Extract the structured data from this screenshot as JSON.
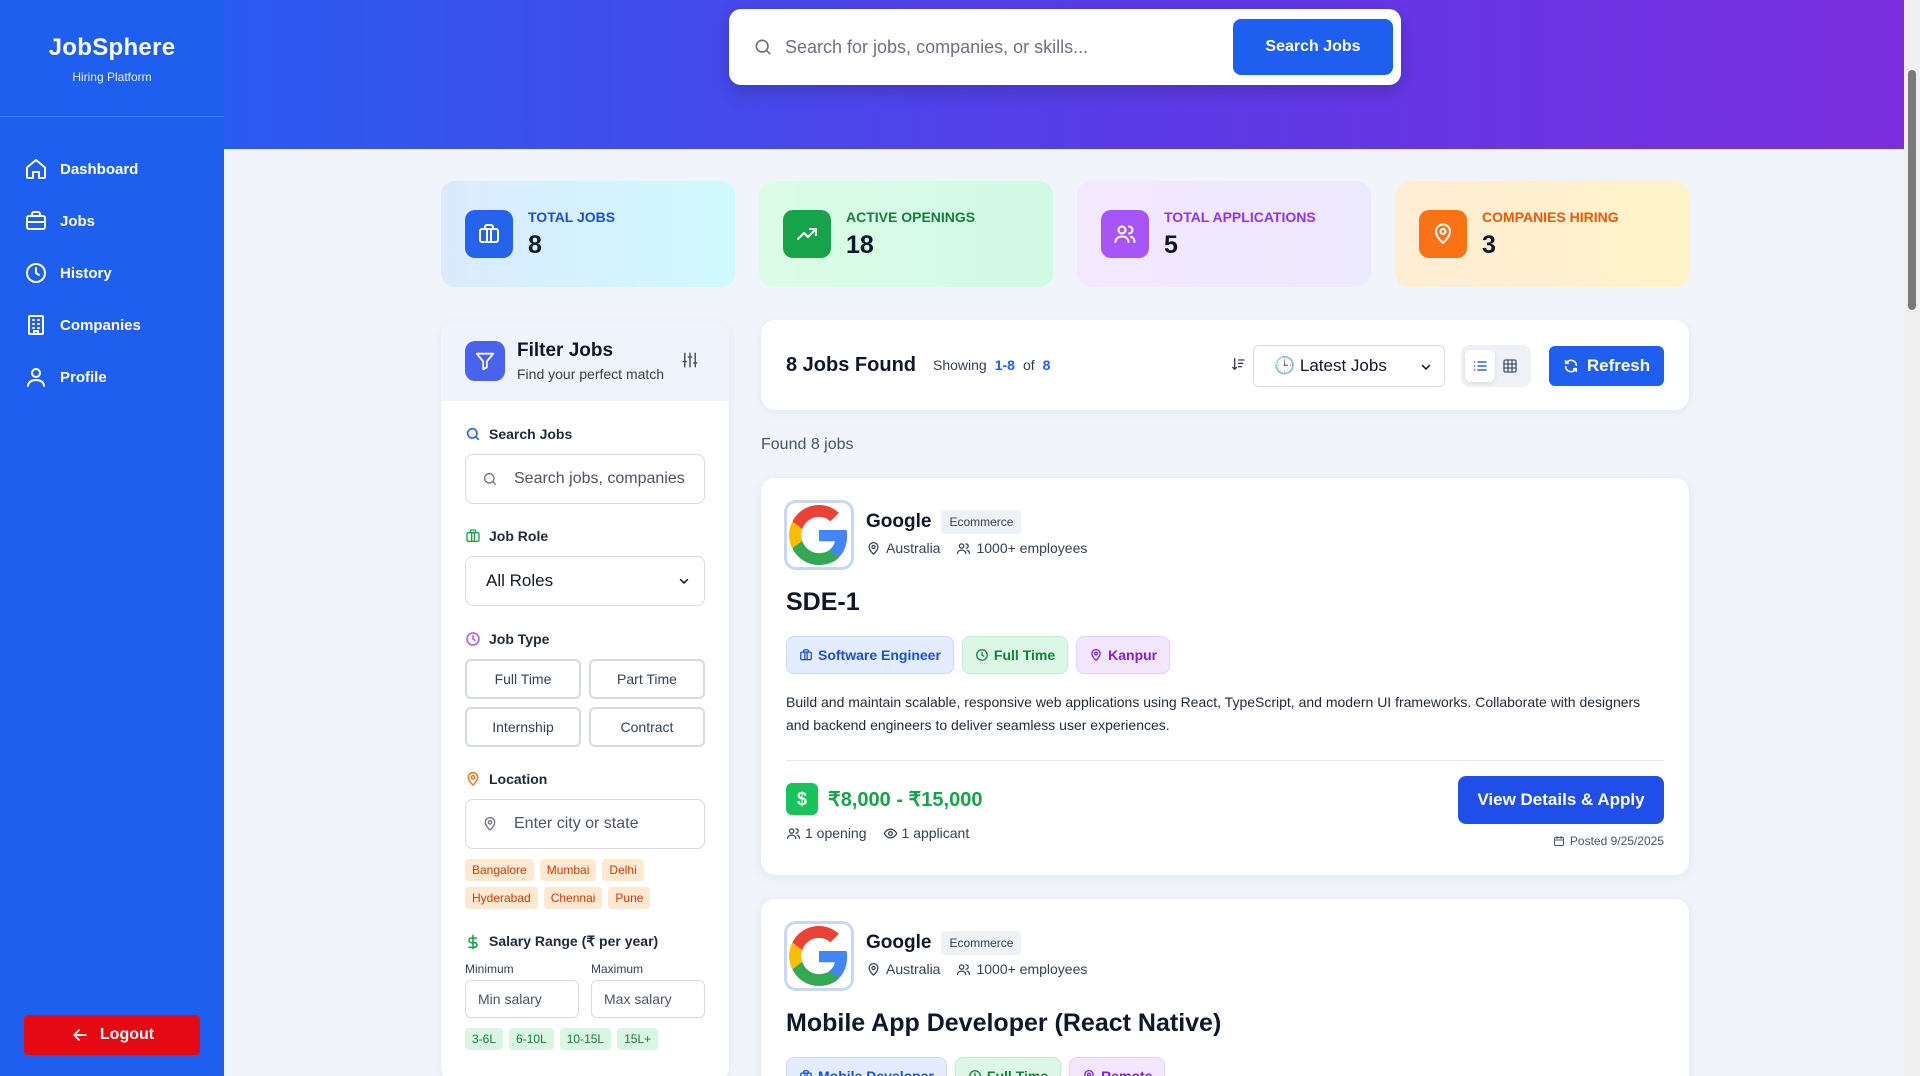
{
  "brand": {
    "name": "JobSphere",
    "subtitle": "Hiring Platform"
  },
  "sidebar": {
    "items": [
      {
        "label": "Dashboard",
        "icon": "home-icon"
      },
      {
        "label": "Jobs",
        "icon": "briefcase-icon"
      },
      {
        "label": "History",
        "icon": "clock-icon"
      },
      {
        "label": "Companies",
        "icon": "building-icon"
      },
      {
        "label": "Profile",
        "icon": "user-icon"
      }
    ],
    "logout_label": "Logout"
  },
  "hero": {
    "search_placeholder": "Search for jobs, companies, or skills...",
    "search_button": "Search Jobs"
  },
  "stats": [
    {
      "label": "TOTAL JOBS",
      "value": "8",
      "icon": "briefcase-icon",
      "color": "#1f5ff0"
    },
    {
      "label": "ACTIVE OPENINGS",
      "value": "18",
      "icon": "trending-up-icon",
      "color": "#16a34a"
    },
    {
      "label": "TOTAL APPLICATIONS",
      "value": "5",
      "icon": "users-icon",
      "color": "#9333ea"
    },
    {
      "label": "COMPANIES HIRING",
      "value": "3",
      "icon": "map-pin-icon",
      "color": "#ea580c"
    }
  ],
  "filter": {
    "title": "Filter Jobs",
    "subtitle": "Find your perfect match",
    "search_label": "Search Jobs",
    "search_placeholder": "Search jobs, companies",
    "role_label": "Job Role",
    "role_selected": "All Roles",
    "type_label": "Job Type",
    "types": [
      "Full Time",
      "Part Time",
      "Internship",
      "Contract"
    ],
    "location_label": "Location",
    "location_placeholder": "Enter city or state",
    "locations": [
      "Bangalore",
      "Mumbai",
      "Delhi",
      "Hyderabad",
      "Chennai",
      "Pune"
    ],
    "salary_label": "Salary Range (₹ per year)",
    "min_label": "Minimum",
    "max_label": "Maximum",
    "min_placeholder": "Min salary",
    "max_placeholder": "Max salary",
    "salary_presets": [
      "3-6L",
      "6-10L",
      "10-15L",
      "15L+"
    ]
  },
  "results": {
    "title": "8 Jobs Found",
    "showing_prefix": "Showing",
    "range": "1-8",
    "of_label": "of",
    "total": "8",
    "sort_selected": "🕒 Latest Jobs",
    "refresh_label": "Refresh",
    "found_text": "Found 8 jobs"
  },
  "jobs": [
    {
      "company": "Google",
      "industry": "Ecommerce",
      "country": "Australia",
      "employees": "1000+ employees",
      "title": "SDE-1",
      "role": "Software Engineer",
      "type": "Full Time",
      "location": "Kanpur",
      "description": "Build and maintain scalable, responsive web applications using React, TypeScript, and modern UI frameworks. Collaborate with designers and backend engineers to deliver seamless user experiences.",
      "salary_symbol": "$",
      "salary": "₹8,000 - ₹15,000",
      "openings": "1 opening",
      "applicants": "1 applicant",
      "apply_label": "View Details & Apply",
      "posted": "Posted 9/25/2025"
    },
    {
      "company": "Google",
      "industry": "Ecommerce",
      "country": "Australia",
      "employees": "1000+ employees",
      "title": "Mobile App Developer (React Native)",
      "role": "Mobile Developer",
      "type": "Full Time",
      "location": "Remote"
    }
  ]
}
